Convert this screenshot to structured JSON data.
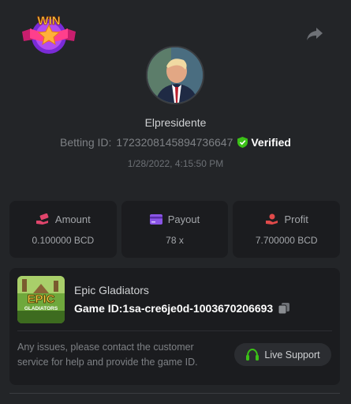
{
  "badge": {
    "text": "WIN"
  },
  "user": {
    "name": "Elpresidente",
    "betting_id_label": "Betting ID:",
    "betting_id": "1723208145894736647",
    "verified_label": "Verified",
    "timestamp": "1/28/2022, 4:15:50 PM"
  },
  "stats": [
    {
      "label": "Amount",
      "value": "0.100000 BCD",
      "icon": "money-hand-icon",
      "color": "#e0456c"
    },
    {
      "label": "Payout",
      "value": "78 x",
      "icon": "card-icon",
      "color": "#8a55e6"
    },
    {
      "label": "Profit",
      "value": "7.700000 BCD",
      "icon": "profit-hand-icon",
      "color": "#e04a4a"
    }
  ],
  "game": {
    "name": "Epic Gladiators",
    "id_label": "Game ID:",
    "id": "1sa-cre6je0d-1003670206693",
    "thumb_title": "EPIC",
    "thumb_subtitle": "GLADIATORS"
  },
  "support": {
    "text": "Any issues, please contact the customer service for help and provide the game ID.",
    "button_label": "Live Support"
  },
  "colors": {
    "verified": "#3bc117",
    "support_icon": "#3bc117",
    "background": "#232528",
    "card": "#1b1c1f"
  }
}
